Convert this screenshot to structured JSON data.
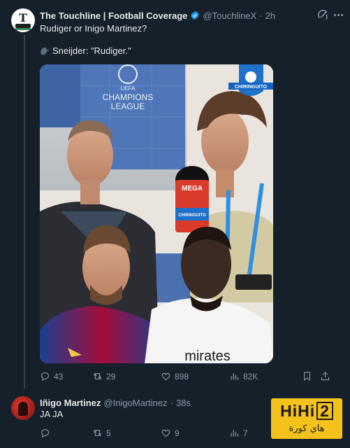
{
  "tweet": {
    "author_name": "The Touchline | Football Coverage",
    "handle": "@TouchlineX",
    "separator": "·",
    "time": "2h",
    "text_line1": "Rudiger or Inigo Martinez?",
    "text_line2": "Sneijder: \"Rudiger.\"",
    "avatar_letter": "T",
    "media": {
      "ucl_line1": "UEFA",
      "ucl_line2": "CHAMPIONS",
      "ucl_line3": "LEAGUE",
      "badge_text": "CHIRINGUITO",
      "mic_top": "MEGA",
      "mic_label": "CHIRINGUITO",
      "shirt_text": "mirates"
    },
    "actions": {
      "replies": "43",
      "reposts": "29",
      "likes": "898",
      "views": "82K"
    }
  },
  "reply": {
    "author_name": "Iñigo Martinez",
    "handle": "@InigoMartinez",
    "separator": "·",
    "time": "38s",
    "text": "JA JA",
    "actions": {
      "replies": "",
      "reposts": "5",
      "likes": "9",
      "views": "7"
    }
  },
  "watermark": {
    "top_text": "HiHi",
    "top_box": "2",
    "bottom_text": "هاي كورة"
  },
  "colors": {
    "background": "#15202b",
    "text_primary": "#e7e9ea",
    "text_secondary": "#8b98a5",
    "verified": "#1d9bf0",
    "watermark": "#f4c21b"
  },
  "icons": [
    "verified-badge-icon",
    "grok-icon",
    "more-icon",
    "speaking-head-icon",
    "reply-icon",
    "repost-icon",
    "like-icon",
    "views-icon",
    "bookmark-icon",
    "share-icon"
  ]
}
